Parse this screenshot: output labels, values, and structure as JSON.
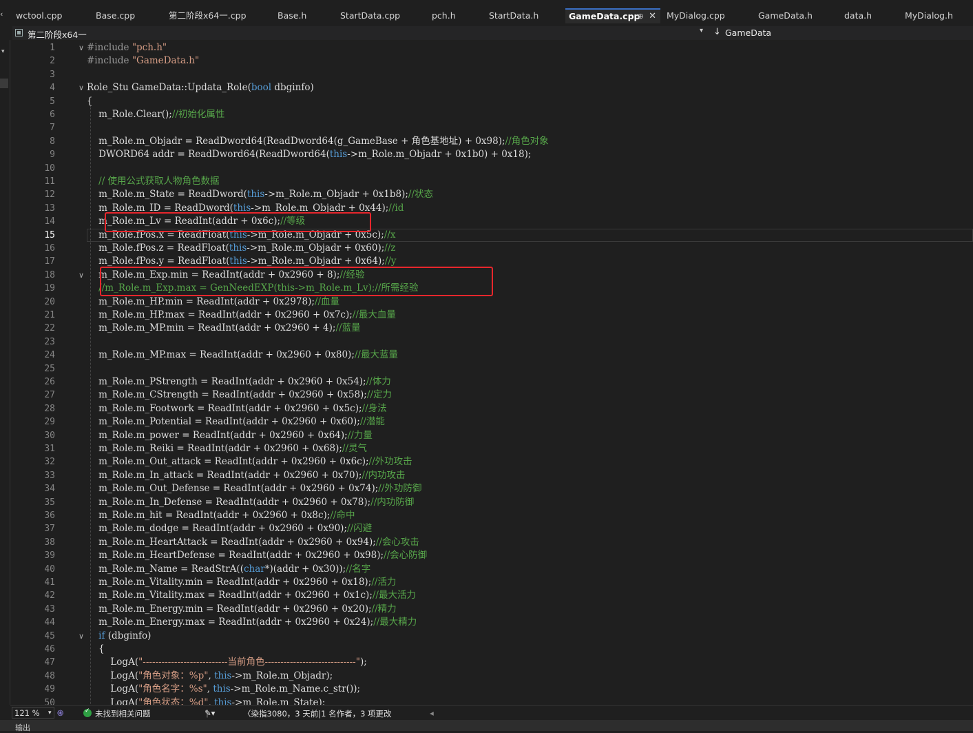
{
  "tabs": [
    {
      "label": "wctool.cpp",
      "active": false
    },
    {
      "label": "Base.cpp",
      "active": false
    },
    {
      "label": "第二阶段x64一.cpp",
      "active": false
    },
    {
      "label": "Base.h",
      "active": false
    },
    {
      "label": "StartData.cpp",
      "active": false
    },
    {
      "label": "pch.h",
      "active": false
    },
    {
      "label": "StartData.h",
      "active": false
    },
    {
      "label": "GameData.cpp",
      "active": true,
      "pin": "⊕",
      "close": "✕"
    },
    {
      "label": "MyDialog.cpp",
      "active": false
    },
    {
      "label": "GameData.h",
      "active": false
    },
    {
      "label": "data.h",
      "active": false
    },
    {
      "label": "MyDialog.h",
      "active": false
    }
  ],
  "navbar": {
    "scope": "第二阶段x64一",
    "member": "GameData",
    "member_arrow": "↓",
    "dropdown_glyph": "▾"
  },
  "editor": {
    "current_line": 15,
    "line_numbers": [
      1,
      2,
      3,
      4,
      5,
      6,
      7,
      8,
      9,
      10,
      11,
      12,
      13,
      14,
      15,
      16,
      17,
      18,
      19,
      20,
      21,
      22,
      23,
      24,
      25,
      26,
      27,
      28,
      29,
      30,
      31,
      32,
      33,
      34,
      35,
      36,
      37,
      38,
      39,
      40,
      41,
      42,
      43,
      44,
      45,
      46,
      47,
      48,
      49,
      50
    ],
    "fold_glyph": "∨",
    "lines": [
      [
        [
          "pp",
          "#include "
        ],
        [
          "str",
          "\"pch.h\""
        ]
      ],
      [
        [
          "pp",
          "#include "
        ],
        [
          "str",
          "\"GameData.h\""
        ]
      ],
      [],
      [
        [
          "t",
          "Role_Stu GameData::Updata_Role("
        ],
        [
          "kw",
          "bool"
        ],
        [
          "t",
          " dbginfo)"
        ]
      ],
      [
        [
          "t",
          "{"
        ]
      ],
      [
        [
          "t",
          "    m_Role.Clear();"
        ],
        [
          "com",
          "//初始化属性"
        ]
      ],
      [],
      [
        [
          "t",
          "    m_Role.m_Objadr = ReadDword64(ReadDword64(g_GameBase + 角色基地址) + 0x98);"
        ],
        [
          "com",
          "//角色对象"
        ]
      ],
      [
        [
          "t",
          "    DWORD64 addr = ReadDword64(ReadDword64("
        ],
        [
          "kw",
          "this"
        ],
        [
          "t",
          "->m_Role.m_Objadr + 0x1b0) + 0x18);"
        ]
      ],
      [],
      [
        [
          "com",
          "    // 使用公式获取人物角色数据"
        ]
      ],
      [
        [
          "t",
          "    m_Role.m_State = ReadDword("
        ],
        [
          "kw",
          "this"
        ],
        [
          "t",
          "->m_Role.m_Objadr + 0x1b8);"
        ],
        [
          "com",
          "//状态"
        ]
      ],
      [
        [
          "t",
          "    m_Role.m_ID = ReadDword("
        ],
        [
          "kw",
          "this"
        ],
        [
          "t",
          "->m_Role.m_Objadr + 0x44);"
        ],
        [
          "com",
          "//id"
        ]
      ],
      [
        [
          "t",
          "    m_Role.m_Lv = ReadInt(addr + 0x6c);"
        ],
        [
          "com",
          "//等级"
        ]
      ],
      [
        [
          "t",
          "    m_Role.fPos.x = ReadFloat("
        ],
        [
          "kw",
          "this"
        ],
        [
          "t",
          "->m_Role.m_Objadr + 0x5c);"
        ],
        [
          "com",
          "//x"
        ]
      ],
      [
        [
          "t",
          "    m_Role.fPos.z = ReadFloat("
        ],
        [
          "kw",
          "this"
        ],
        [
          "t",
          "->m_Role.m_Objadr + 0x60);"
        ],
        [
          "com",
          "//z"
        ]
      ],
      [
        [
          "t",
          "    m_Role.fPos.y = ReadFloat("
        ],
        [
          "kw",
          "this"
        ],
        [
          "t",
          "->m_Role.m_Objadr + 0x64);"
        ],
        [
          "com",
          "//y"
        ]
      ],
      [
        [
          "t",
          "    m_Role.m_Exp.min = ReadInt(addr + 0x2960 + 8);"
        ],
        [
          "com",
          "//经验"
        ]
      ],
      [
        [
          "com",
          "    //m_Role.m_Exp.max = GenNeedEXP(this->m_Role.m_Lv);//所需经验"
        ]
      ],
      [
        [
          "t",
          "    m_Role.m_HP.min = ReadInt(addr + 0x2978);"
        ],
        [
          "com",
          "//血量"
        ]
      ],
      [
        [
          "t",
          "    m_Role.m_HP.max = ReadInt(addr + 0x2960 + 0x7c);"
        ],
        [
          "com",
          "//最大血量"
        ]
      ],
      [
        [
          "t",
          "    m_Role.m_MP.min = ReadInt(addr + 0x2960 + 4);"
        ],
        [
          "com",
          "//蓝量"
        ]
      ],
      [],
      [
        [
          "t",
          "    m_Role.m_MP.max = ReadInt(addr + 0x2960 + 0x80);"
        ],
        [
          "com",
          "//最大蓝量"
        ]
      ],
      [],
      [
        [
          "t",
          "    m_Role.m_PStrength = ReadInt(addr + 0x2960 + 0x54);"
        ],
        [
          "com",
          "//体力"
        ]
      ],
      [
        [
          "t",
          "    m_Role.m_CStrength = ReadInt(addr + 0x2960 + 0x58);"
        ],
        [
          "com",
          "//定力"
        ]
      ],
      [
        [
          "t",
          "    m_Role.m_Footwork = ReadInt(addr + 0x2960 + 0x5c);"
        ],
        [
          "com",
          "//身法"
        ]
      ],
      [
        [
          "t",
          "    m_Role.m_Potential = ReadInt(addr + 0x2960 + 0x60);"
        ],
        [
          "com",
          "//潜能"
        ]
      ],
      [
        [
          "t",
          "    m_Role.m_power = ReadInt(addr + 0x2960 + 0x64);"
        ],
        [
          "com",
          "//力量"
        ]
      ],
      [
        [
          "t",
          "    m_Role.m_Reiki = ReadInt(addr + 0x2960 + 0x68);"
        ],
        [
          "com",
          "//灵气"
        ]
      ],
      [
        [
          "t",
          "    m_Role.m_Out_attack = ReadInt(addr + 0x2960 + 0x6c);"
        ],
        [
          "com",
          "//外功攻击"
        ]
      ],
      [
        [
          "t",
          "    m_Role.m_In_attack = ReadInt(addr + 0x2960 + 0x70);"
        ],
        [
          "com",
          "//内功攻击"
        ]
      ],
      [
        [
          "t",
          "    m_Role.m_Out_Defense = ReadInt(addr + 0x2960 + 0x74);"
        ],
        [
          "com",
          "//外功防御"
        ]
      ],
      [
        [
          "t",
          "    m_Role.m_In_Defense = ReadInt(addr + 0x2960 + 0x78);"
        ],
        [
          "com",
          "//内功防御"
        ]
      ],
      [
        [
          "t",
          "    m_Role.m_hit = ReadInt(addr + 0x2960 + 0x8c);"
        ],
        [
          "com",
          "//命中"
        ]
      ],
      [
        [
          "t",
          "    m_Role.m_dodge = ReadInt(addr + 0x2960 + 0x90);"
        ],
        [
          "com",
          "//闪避"
        ]
      ],
      [
        [
          "t",
          "    m_Role.m_HeartAttack = ReadInt(addr + 0x2960 + 0x94);"
        ],
        [
          "com",
          "//会心攻击"
        ]
      ],
      [
        [
          "t",
          "    m_Role.m_HeartDefense = ReadInt(addr + 0x2960 + 0x98);"
        ],
        [
          "com",
          "//会心防御"
        ]
      ],
      [
        [
          "t",
          "    m_Role.m_Name = ReadStrA(("
        ],
        [
          "kw",
          "char"
        ],
        [
          "t",
          "*)(addr + 0x30));"
        ],
        [
          "com",
          "//名字"
        ]
      ],
      [
        [
          "t",
          "    m_Role.m_Vitality.min = ReadInt(addr + 0x2960 + 0x18);"
        ],
        [
          "com",
          "//活力"
        ]
      ],
      [
        [
          "t",
          "    m_Role.m_Vitality.max = ReadInt(addr + 0x2960 + 0x1c);"
        ],
        [
          "com",
          "//最大活力"
        ]
      ],
      [
        [
          "t",
          "    m_Role.m_Energy.min = ReadInt(addr + 0x2960 + 0x20);"
        ],
        [
          "com",
          "//精力"
        ]
      ],
      [
        [
          "t",
          "    m_Role.m_Energy.max = ReadInt(addr + 0x2960 + 0x24);"
        ],
        [
          "com",
          "//最大精力"
        ]
      ],
      [
        [
          "t",
          "    "
        ],
        [
          "kw",
          "if"
        ],
        [
          "t",
          " (dbginfo)"
        ]
      ],
      [
        [
          "t",
          "    {"
        ]
      ],
      [
        [
          "t",
          "        LogA("
        ],
        [
          "str",
          "\"---------------------------当前角色-----------------------------\""
        ],
        [
          "t",
          ");"
        ]
      ],
      [
        [
          "t",
          "        LogA("
        ],
        [
          "str",
          "\"角色对象：%p\""
        ],
        [
          "t",
          ", "
        ],
        [
          "kw",
          "this"
        ],
        [
          "t",
          "->m_Role.m_Objadr);"
        ]
      ],
      [
        [
          "t",
          "        LogA("
        ],
        [
          "str",
          "\"角色名字：%s\""
        ],
        [
          "t",
          ", "
        ],
        [
          "kw",
          "this"
        ],
        [
          "t",
          "->m_Role.m_Name.c_str());"
        ]
      ],
      [
        [
          "t",
          "        LogA("
        ],
        [
          "str",
          "\"角色状态：%d\""
        ],
        [
          "t",
          ", "
        ],
        [
          "kw",
          "this"
        ],
        [
          "t",
          "->m_Role.m_State);"
        ]
      ]
    ]
  },
  "statusbar": {
    "zoom": "121 %",
    "issues": "未找到相关问题",
    "git": "〈染指3080，3 天前|1 名作者，3 项更改",
    "brush_icon": "✎▾",
    "left_arrow": "◂"
  },
  "bottom_panel": {
    "label": "输出"
  },
  "colors": {
    "keyword": "#569cd6",
    "string": "#d69d85",
    "comment": "#57a64a",
    "highlight_box": "#e8262c",
    "active_tab_accent": "#3a6fc4"
  }
}
